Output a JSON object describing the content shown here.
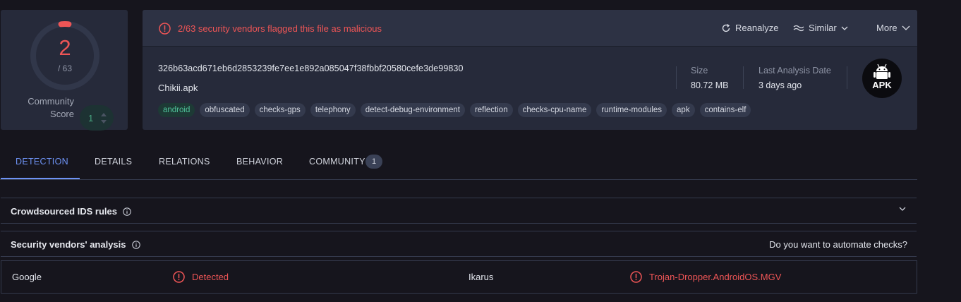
{
  "score": {
    "detected": "2",
    "total_label": "/ 63",
    "detection_fraction": 0.032,
    "community_label_line1": "Community",
    "community_label_line2": "Score",
    "community_value": "1",
    "accent_color": "#ee5556",
    "ring_color": "#31374a"
  },
  "header": {
    "alert_text": "2/63 security vendors flagged this file as malicious",
    "reanalyze_label": "Reanalyze",
    "similar_label": "Similar",
    "more_label": "More"
  },
  "file": {
    "hash": "326b63acd671eb6d2853239fe7ee1e892a085047f38fbbf20580cefe3de99830",
    "name": "Chikii.apk",
    "tags": [
      "android",
      "obfuscated",
      "checks-gps",
      "telephony",
      "detect-debug-environment",
      "reflection",
      "checks-cpu-name",
      "runtime-modules",
      "apk",
      "contains-elf"
    ],
    "size_label": "Size",
    "size_value": "80.72 MB",
    "last_analysis_label": "Last Analysis Date",
    "last_analysis_value": "3 days ago",
    "type_badge": "APK"
  },
  "tabs": [
    {
      "label": "DETECTION",
      "active": true
    },
    {
      "label": "DETAILS"
    },
    {
      "label": "RELATIONS"
    },
    {
      "label": "BEHAVIOR"
    },
    {
      "label": "COMMUNITY",
      "count": "1"
    }
  ],
  "sections": {
    "ids_title": "Crowdsourced IDS rules",
    "vendors_title": "Security vendors' analysis",
    "automate_link": "Do you want to automate checks?"
  },
  "vendors": [
    {
      "name": "Google",
      "result": "Detected"
    },
    {
      "name": "Ikarus",
      "result": "Trojan-Dropper.AndroidOS.MGV"
    }
  ]
}
